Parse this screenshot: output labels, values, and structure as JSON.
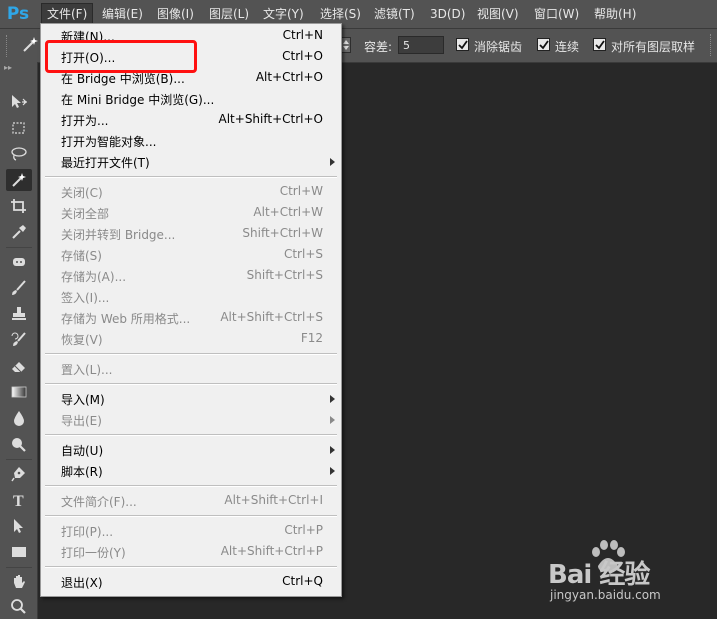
{
  "app": {
    "logo": "Ps"
  },
  "menubar": {
    "items": [
      {
        "label": "文件(F)",
        "active": true
      },
      {
        "label": "编辑(E)"
      },
      {
        "label": "图像(I)"
      },
      {
        "label": "图层(L)"
      },
      {
        "label": "文字(Y)"
      },
      {
        "label": "选择(S)"
      },
      {
        "label": "滤镜(T)"
      },
      {
        "label": "3D(D)"
      },
      {
        "label": "视图(V)"
      },
      {
        "label": "窗口(W)"
      },
      {
        "label": "帮助(H)"
      }
    ]
  },
  "options": {
    "tolerance_label": "容差:",
    "tolerance_value": "5",
    "antialias_label": "消除锯齿",
    "antialias_checked": true,
    "contiguous_label": "连续",
    "contiguous_checked": true,
    "sample_all_label": "对所有图层取样",
    "sample_all_checked": true
  },
  "toolbar": {
    "tools": [
      "move-tool-icon",
      "marquee-tool-icon",
      "lasso-tool-icon",
      "magic-wand-tool-icon",
      "crop-tool-icon",
      "eyedropper-tool-icon",
      "healing-brush-tool-icon",
      "brush-tool-icon",
      "clone-stamp-tool-icon",
      "history-brush-tool-icon",
      "eraser-tool-icon",
      "gradient-tool-icon",
      "blur-tool-icon",
      "dodge-tool-icon",
      "pen-tool-icon",
      "type-tool-icon",
      "path-selection-tool-icon",
      "rectangle-tool-icon",
      "hand-tool-icon",
      "zoom-tool-icon"
    ]
  },
  "file_menu": {
    "items": [
      {
        "label": "新建(N)...",
        "shortcut": "Ctrl+N"
      },
      {
        "label": "打开(O)...",
        "shortcut": "Ctrl+O",
        "highlighted": true
      },
      {
        "label": "在 Bridge 中浏览(B)...",
        "shortcut": "Alt+Ctrl+O"
      },
      {
        "label": "在 Mini Bridge 中浏览(G)...",
        "shortcut": ""
      },
      {
        "label": "打开为...",
        "shortcut": "Alt+Shift+Ctrl+O"
      },
      {
        "label": "打开为智能对象...",
        "shortcut": ""
      },
      {
        "label": "最近打开文件(T)",
        "shortcut": "",
        "submenu": true
      },
      {
        "separator": true
      },
      {
        "label": "关闭(C)",
        "shortcut": "Ctrl+W",
        "disabled": true
      },
      {
        "label": "关闭全部",
        "shortcut": "Alt+Ctrl+W",
        "disabled": true
      },
      {
        "label": "关闭并转到 Bridge...",
        "shortcut": "Shift+Ctrl+W",
        "disabled": true
      },
      {
        "label": "存储(S)",
        "shortcut": "Ctrl+S",
        "disabled": true
      },
      {
        "label": "存储为(A)...",
        "shortcut": "Shift+Ctrl+S",
        "disabled": true
      },
      {
        "label": "签入(I)...",
        "shortcut": "",
        "disabled": true
      },
      {
        "label": "存储为 Web 所用格式...",
        "shortcut": "Alt+Shift+Ctrl+S",
        "disabled": true
      },
      {
        "label": "恢复(V)",
        "shortcut": "F12",
        "disabled": true
      },
      {
        "separator": true
      },
      {
        "label": "置入(L)...",
        "shortcut": "",
        "disabled": true
      },
      {
        "separator": true
      },
      {
        "label": "导入(M)",
        "shortcut": "",
        "submenu": true
      },
      {
        "label": "导出(E)",
        "shortcut": "",
        "submenu": true,
        "disabled": true
      },
      {
        "separator": true
      },
      {
        "label": "自动(U)",
        "shortcut": "",
        "submenu": true
      },
      {
        "label": "脚本(R)",
        "shortcut": "",
        "submenu": true
      },
      {
        "separator": true
      },
      {
        "label": "文件简介(F)...",
        "shortcut": "Alt+Shift+Ctrl+I",
        "disabled": true
      },
      {
        "separator": true
      },
      {
        "label": "打印(P)...",
        "shortcut": "Ctrl+P",
        "disabled": true
      },
      {
        "label": "打印一份(Y)",
        "shortcut": "Alt+Shift+Ctrl+P",
        "disabled": true
      },
      {
        "separator": true
      },
      {
        "label": "退出(X)",
        "shortcut": "Ctrl+Q"
      }
    ]
  },
  "watermark": {
    "brand": "Bai 经验",
    "url": "jingyan.baidu.com"
  }
}
